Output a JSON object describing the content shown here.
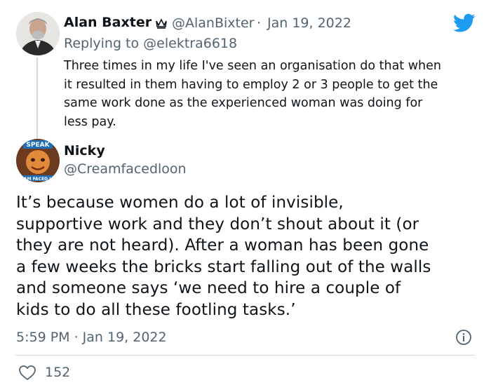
{
  "reply": {
    "author_name": "Alan Baxter",
    "author_handle": "@AlanBixter",
    "separator": "·",
    "date": "Jan 19, 2022",
    "replying_prefix": "Replying to",
    "replying_handle": "@elektra6618",
    "text_lines": [
      "Three times in my life I've seen an organisation do that when",
      "it resulted in them having to employ 2 or 3 people to get the",
      "same work done as the experienced woman was doing for",
      "less pay."
    ]
  },
  "main": {
    "author_name": "Nicky",
    "author_handle": "@Creamfacedloon",
    "avatar_caption_top": "SPEAK",
    "avatar_caption_bottom": "AM FACED L",
    "text_lines": [
      "It’s because women do a lot of invisible,",
      "supportive work and they don’t shout about it (or",
      "they are not heard). After a woman has been gone",
      "a few weeks the bricks start falling out of the walls",
      "and someone says ‘we need to hire a couple of",
      "kids to do all these footling tasks.’"
    ],
    "timestamp": "5:59 PM · Jan 19, 2022",
    "like_count": "152"
  },
  "icons": {
    "twitter": "twitter-bird-icon",
    "badge": "crown-badge-icon",
    "info": "info-icon",
    "like": "heart-icon"
  },
  "colors": {
    "twitter_blue": "#1d9bf0",
    "secondary_text": "#536471",
    "primary_text": "#0f1419",
    "divider": "#cfd9de"
  }
}
